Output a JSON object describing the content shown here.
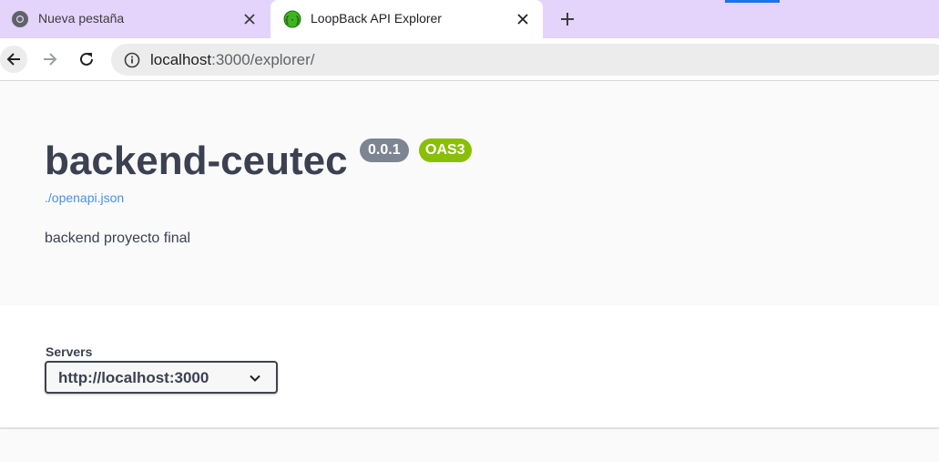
{
  "browser": {
    "tabs": [
      {
        "title": "Nueva pestaña",
        "icon": "chrome-icon",
        "active": false
      },
      {
        "title": "LoopBack API Explorer",
        "icon": "loopback-icon",
        "active": true
      }
    ],
    "new_tab": "+",
    "address": {
      "host": "localhost",
      "path": ":3000/explorer/"
    }
  },
  "api": {
    "title": "backend-ceutec",
    "version": "0.0.1",
    "oas": "OAS3",
    "spec_link": "./openapi.json",
    "description": "backend proyecto final"
  },
  "servers": {
    "label": "Servers",
    "selected": "http://localhost:3000"
  },
  "colors": {
    "tabstrip": "#e4d3fb",
    "title": "#3b4151",
    "version_badge": "#7d8492",
    "oas_badge": "#89bf04",
    "link": "#4990e2"
  }
}
